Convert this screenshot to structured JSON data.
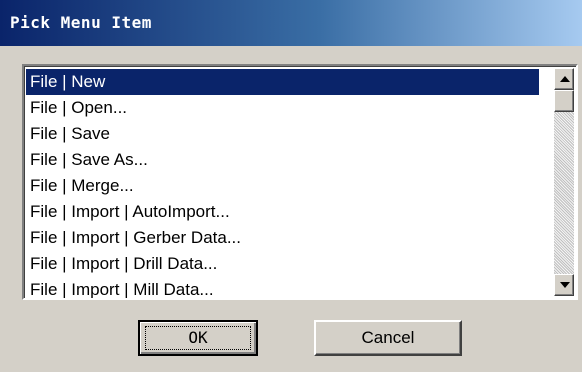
{
  "window": {
    "title": "Pick Menu Item"
  },
  "list": {
    "items": [
      {
        "label": "File | New",
        "selected": true
      },
      {
        "label": "File | Open...",
        "selected": false
      },
      {
        "label": "File | Save",
        "selected": false
      },
      {
        "label": "File | Save As...",
        "selected": false
      },
      {
        "label": "File | Merge...",
        "selected": false
      },
      {
        "label": "File | Import | AutoImport...",
        "selected": false
      },
      {
        "label": "File | Import | Gerber Data...",
        "selected": false
      },
      {
        "label": "File | Import | Drill Data...",
        "selected": false
      },
      {
        "label": "File | Import | Mill Data...",
        "selected": false
      }
    ]
  },
  "buttons": {
    "ok_label": "OK",
    "cancel_label": "Cancel"
  },
  "colors": {
    "title_gradient_start": "#0a246a",
    "title_gradient_end": "#a6caf0",
    "selection_bg": "#0a246a",
    "dialog_bg": "#d4d0c8"
  },
  "icons": {
    "scroll_up": "up-arrow-icon",
    "scroll_down": "down-arrow-icon"
  }
}
